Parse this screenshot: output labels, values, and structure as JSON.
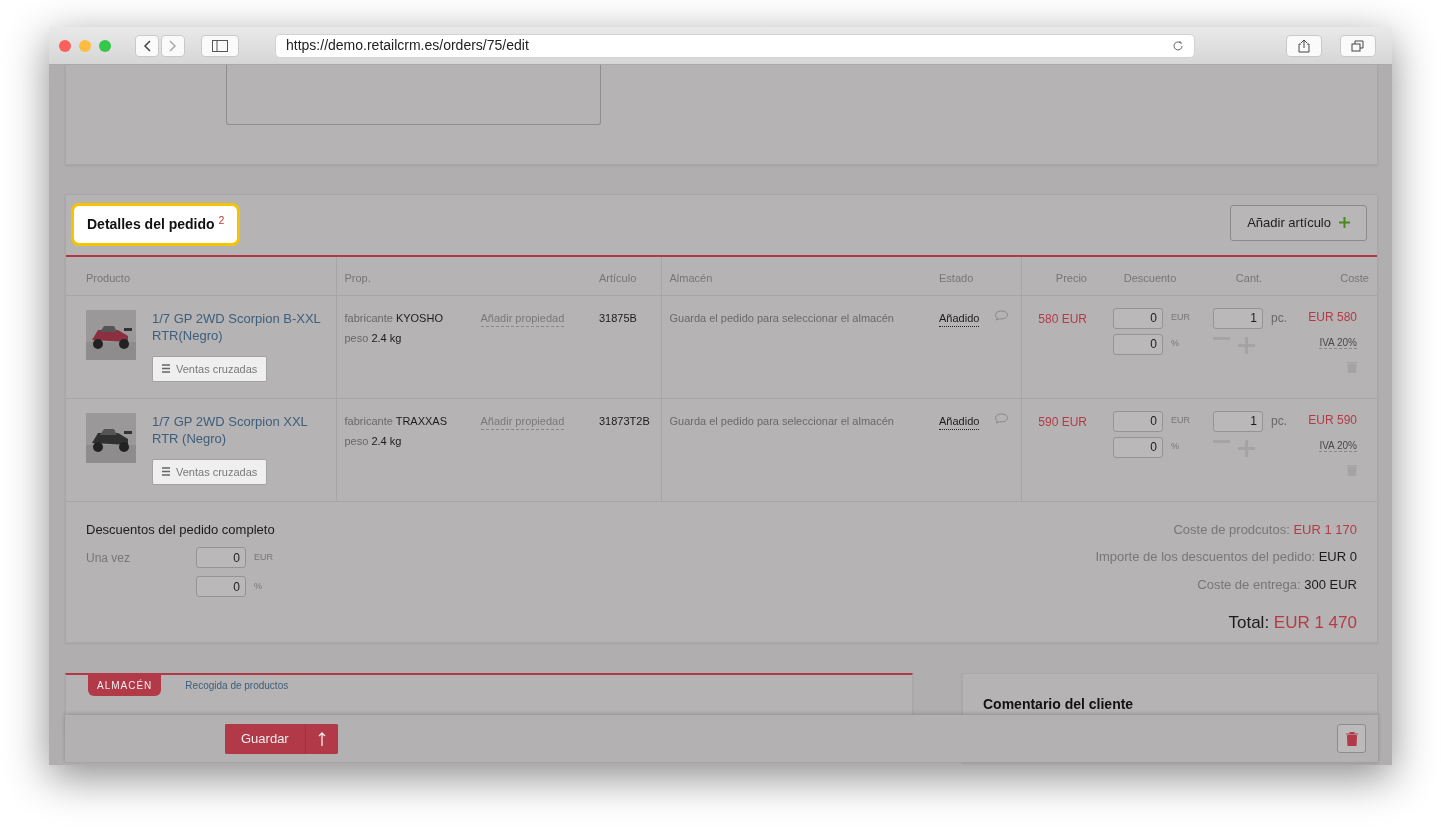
{
  "browser": {
    "url": "https://demo.retailcrm.es/orders/75/edit"
  },
  "order_items": {
    "title": "Detalles del pedido",
    "count": "2",
    "add_button": "Añadir artículo",
    "columns": [
      "Producto",
      "Prop.",
      "Artículo",
      "Almacén",
      "Estado",
      "Precio",
      "Descuento",
      "Cant.",
      "Coste"
    ],
    "rows": [
      {
        "name": "1/7 GP 2WD Scorpion B-XXL RTR(Negro)",
        "cross_sell": "Ventas cruzadas",
        "properties": [
          {
            "label": "fabricante",
            "value": "KYOSHO"
          },
          {
            "label": "peso",
            "value": "2.4 kg"
          }
        ],
        "add_property": "Añadir propiedad",
        "sku": "31875B",
        "warehouse": "Guarda el pedido para seleccionar el almacén",
        "status": "Añadido",
        "price": "580 EUR",
        "discount_amount": "0",
        "discount_currency": "EUR",
        "discount_percent": "0",
        "percent_sign": "%",
        "quantity": "1",
        "unit": "pc.",
        "cost": "EUR 580",
        "vat": "IVA 20%"
      },
      {
        "name": "1/7 GP 2WD Scorpion XXL RTR (Negro)",
        "cross_sell": "Ventas cruzadas",
        "properties": [
          {
            "label": "fabricante",
            "value": "TRAXXAS"
          },
          {
            "label": "peso",
            "value": "2.4 kg"
          }
        ],
        "add_property": "Añadir propiedad",
        "sku": "31873T2B",
        "warehouse": "Guarda el pedido para seleccionar el almacén",
        "status": "Añadido",
        "price": "590 EUR",
        "discount_amount": "0",
        "discount_currency": "EUR",
        "discount_percent": "0",
        "percent_sign": "%",
        "quantity": "1",
        "unit": "pc.",
        "cost": "EUR 590",
        "vat": "IVA 20%"
      }
    ]
  },
  "order_discounts": {
    "title": "Descuentos del pedido completo",
    "label": "Una vez",
    "amount": "0",
    "currency": "EUR",
    "percent": "0",
    "percent_sign": "%"
  },
  "totals": [
    {
      "label": "Coste de prodcutos:",
      "value": "EUR 1 170",
      "kind": "accent"
    },
    {
      "label": "Importe de los descuentos del pedido:",
      "value": "EUR 0",
      "kind": "plain"
    },
    {
      "label": "Coste de entrega:",
      "value": "300 EUR",
      "kind": "plain"
    }
  ],
  "grand_total": {
    "label": "Total:",
    "value": "EUR 1 470"
  },
  "warehouse_section": {
    "badge": "ALMACÉN",
    "link": "Recogida de productos"
  },
  "comment": {
    "title": "Comentario del cliente"
  },
  "footer": {
    "save_button": "Guardar"
  }
}
